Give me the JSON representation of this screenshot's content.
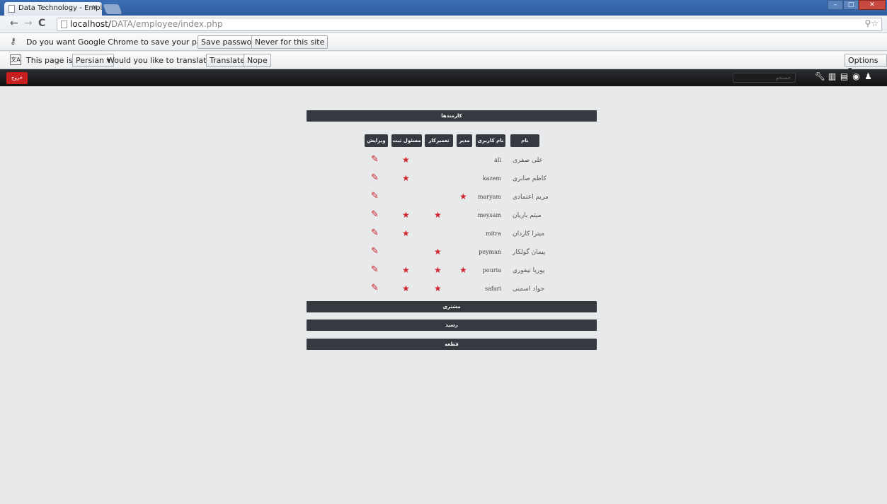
{
  "browser": {
    "tab_title": "Data Technology - Emplo",
    "tab_close": "×",
    "url_host": "localhost/",
    "url_path": "DATA/employee/index.php",
    "url_tools": "⚲☆",
    "win_min": "–",
    "win_max": "□",
    "win_close": "✕"
  },
  "password_bar": {
    "message": "Do you want Google Chrome to save your password?",
    "save_label": "Save password",
    "never_label": "Never for this site"
  },
  "translate_bar": {
    "prefix": "This page is in",
    "language": "Persian ▾",
    "question": "Would you like to translate it?",
    "translate_label": "Translate",
    "nope_label": "Nope",
    "options_label": "Options ▾"
  },
  "app": {
    "logout_label": "خروج",
    "search_placeholder": "جستجو"
  },
  "sections": {
    "employees": "کارمندها",
    "customer": "مشتری",
    "receipt": "رسید",
    "piece": "قطعه"
  },
  "columns": [
    "نام",
    "نام کاربری",
    "مدیر",
    "تعمیرکار",
    "مسئول ثبت",
    "ویرایش"
  ],
  "employees": [
    {
      "name": "علی صفری",
      "username": "ali",
      "manager": false,
      "repair": false,
      "registrar": true
    },
    {
      "name": "کاظم صابری",
      "username": "kazem",
      "manager": false,
      "repair": false,
      "registrar": true
    },
    {
      "name": "مریم اعتمادی",
      "username": "maryam",
      "manager": true,
      "repair": false,
      "registrar": false
    },
    {
      "name": "میثم باریان",
      "username": "meysam",
      "manager": false,
      "repair": true,
      "registrar": true
    },
    {
      "name": "میترا کاردان",
      "username": "mitra",
      "manager": false,
      "repair": false,
      "registrar": true
    },
    {
      "name": "پیمان گولکار",
      "username": "peyman",
      "manager": false,
      "repair": true,
      "registrar": false
    },
    {
      "name": "پوریا تیفوری",
      "username": "pouria",
      "manager": true,
      "repair": true,
      "registrar": true
    },
    {
      "name": "جواد اسمنی",
      "username": "safari",
      "manager": false,
      "repair": true,
      "registrar": true
    }
  ]
}
